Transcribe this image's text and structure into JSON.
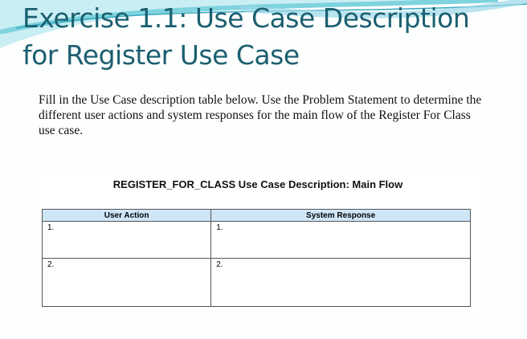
{
  "title": {
    "line1": "Exercise 1.1: Use Case Description",
    "line2": "for Register Use Case"
  },
  "instructions": "Fill in the Use Case description table below. Use the Problem Statement to determine the different user actions and system responses for the main flow of the Register For Class use case.",
  "table": {
    "caption": "REGISTER_FOR_CLASS  Use Case Description: Main Flow",
    "headers": [
      "User Action",
      "System Response"
    ],
    "rows": [
      [
        "1.",
        "1."
      ],
      [
        "2.",
        "2."
      ]
    ]
  },
  "colors": {
    "title": "#1b5f70",
    "header_fill": "#cfe6f7"
  }
}
